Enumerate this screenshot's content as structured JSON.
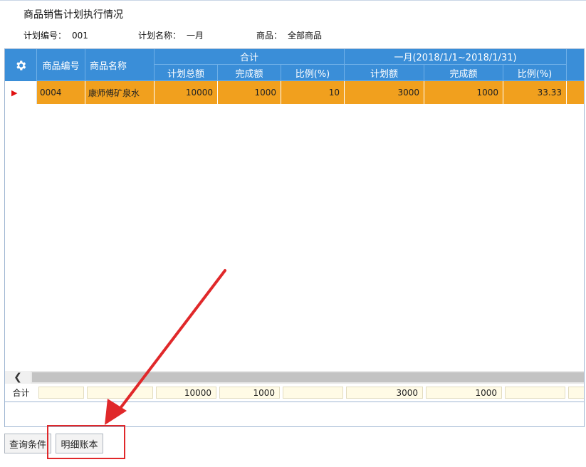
{
  "page": {
    "title": "商品销售计划执行情况",
    "plan_no_label": "计划编号：",
    "plan_no": "001",
    "plan_name_label": "计划名称：",
    "plan_name": "一月",
    "product_label": "商品：",
    "product": "全部商品"
  },
  "grid": {
    "settings_icon": "gear-icon",
    "headers": {
      "code": "商品编号",
      "name": "商品名称",
      "total_group": "合计",
      "total_plan": "计划总额",
      "total_done": "完成额",
      "total_ratio": "比例(%)",
      "month_group": "一月(2018/1/1~2018/1/31)",
      "month_plan": "计划额",
      "month_done": "完成额",
      "month_ratio": "比例(%)"
    },
    "rows": [
      {
        "marker": "▶",
        "code": "0004",
        "name": "康师傅矿泉水",
        "total_plan": "10000",
        "total_done": "1000",
        "total_ratio": "10",
        "month_plan": "3000",
        "month_done": "1000",
        "month_ratio": "33.33"
      }
    ],
    "scroll_left": "❮",
    "footer": {
      "label": "合计",
      "total_plan": "10000",
      "total_done": "1000",
      "month_plan": "3000",
      "month_done": "1000"
    }
  },
  "buttons": {
    "query": "查询条件",
    "detail": "明细账本"
  },
  "colors": {
    "header_bg": "#3a8ed8",
    "selected_row": "#f1a01e",
    "annotation_red": "#e0282a"
  }
}
